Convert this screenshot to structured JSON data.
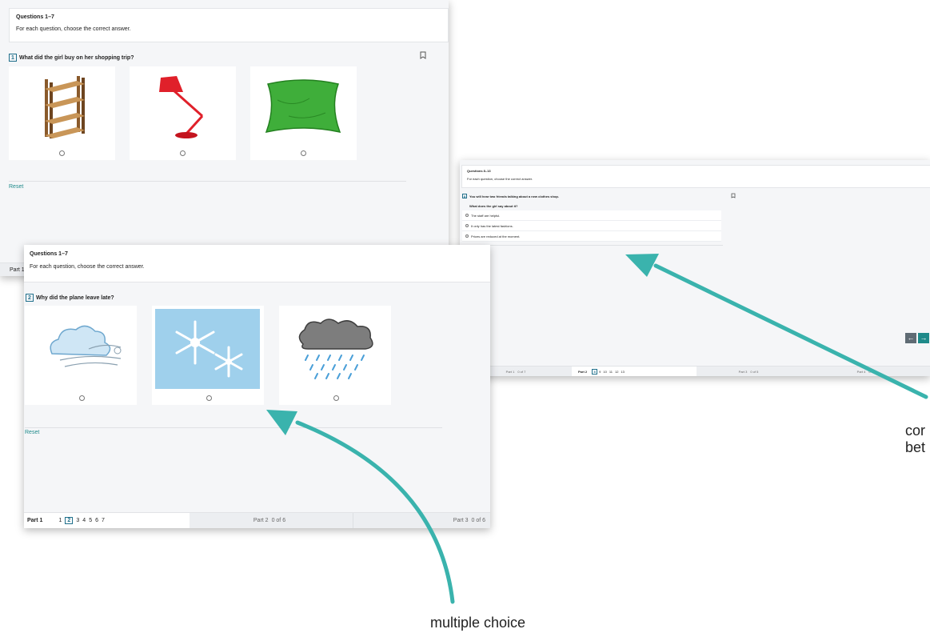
{
  "screen1": {
    "heading": "Questions 1–7",
    "instruction": "For each question, choose the correct answer.",
    "question_number": "1",
    "question_text": "What did the girl buy on her shopping trip?",
    "reset_label": "Reset",
    "footer_part_label": "Part 1",
    "options": [
      {
        "icon": "bookshelf-icon"
      },
      {
        "icon": "desk-lamp-icon"
      },
      {
        "icon": "cushion-icon"
      }
    ]
  },
  "screen2": {
    "heading": "Questions 1–7",
    "instruction": "For each question, choose the correct answer.",
    "question_number": "2",
    "question_text": "Why did the plane leave late?",
    "reset_label": "Reset",
    "options": [
      {
        "icon": "wind-cloud-icon"
      },
      {
        "icon": "snowflakes-icon"
      },
      {
        "icon": "rain-cloud-icon"
      }
    ],
    "footer": {
      "part1_label": "Part 1",
      "part1_numbers": [
        "1",
        "2",
        "3",
        "4",
        "5",
        "6",
        "7"
      ],
      "current_number": "2",
      "part2_label": "Part 2",
      "part2_status": "0 of 6",
      "part3_label": "Part 3",
      "part3_status": "0 of 6"
    }
  },
  "screen3": {
    "heading": "Questions 8–13",
    "instruction": "For each question, choose the correct answer.",
    "question_number": "8",
    "question_text": "You will hear two friends talking about a new clothes shop.",
    "sub_question": "What does the girl say about it?",
    "options": [
      {
        "text": "The staff are helpful."
      },
      {
        "text": "It only has the latest fashions."
      },
      {
        "text": "Prices are reduced at the moment."
      }
    ],
    "reset_label": "Reset",
    "footer": {
      "part1_label": "Part 1",
      "part1_status": "0 of 7",
      "part2_label": "Part 2",
      "part2_numbers": [
        "8",
        "9",
        "10",
        "11",
        "12",
        "13"
      ],
      "current_number": "8",
      "part3_label": "Part 3",
      "part3_status": "0 of 5",
      "part4_label": "Part 4",
      "part4_status": "0 of 5"
    }
  },
  "callouts": {
    "multiple_choice": "multiple choice",
    "right_line1": "cor",
    "right_line2": "bet"
  },
  "colors": {
    "accent": "#1f6f8b",
    "arrow": "#3ab3ad",
    "nav_button": "#5f6b74",
    "nav_button_active": "#1f8a8a"
  }
}
